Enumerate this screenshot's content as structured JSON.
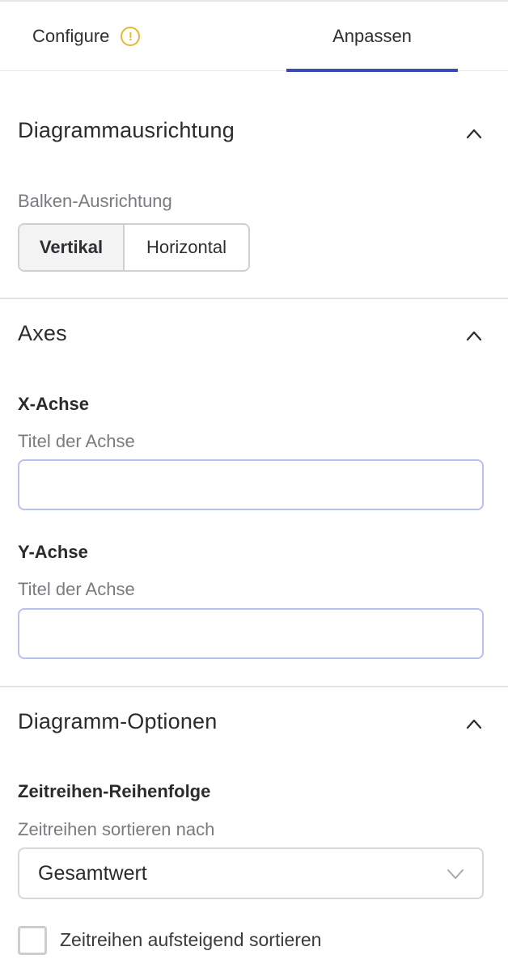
{
  "tabs": {
    "configure": "Configure",
    "configure_warning": "!",
    "anpassen": "Anpassen"
  },
  "orientation": {
    "title": "Diagrammausrichtung",
    "label": "Balken-Ausrichtung",
    "options": [
      "Vertikal",
      "Horizontal"
    ],
    "selected": "Vertikal"
  },
  "axes": {
    "title": "Axes",
    "x_heading": "X-Achse",
    "x_label": "Titel der Achse",
    "x_value": "",
    "y_heading": "Y-Achse",
    "y_label": "Titel der Achse",
    "y_value": ""
  },
  "chart_options": {
    "title": "Diagramm-Optionen",
    "order_heading": "Zeitreihen-Reihenfolge",
    "sort_label": "Zeitreihen sortieren nach",
    "sort_value": "Gesamtwert",
    "ascending_label": "Zeitreihen aufsteigend sortieren",
    "ascending_checked": false
  },
  "colors": {
    "accent": "#3b4bb5",
    "warning": "#e8b630",
    "input_focus_border": "#b9c0f0"
  }
}
